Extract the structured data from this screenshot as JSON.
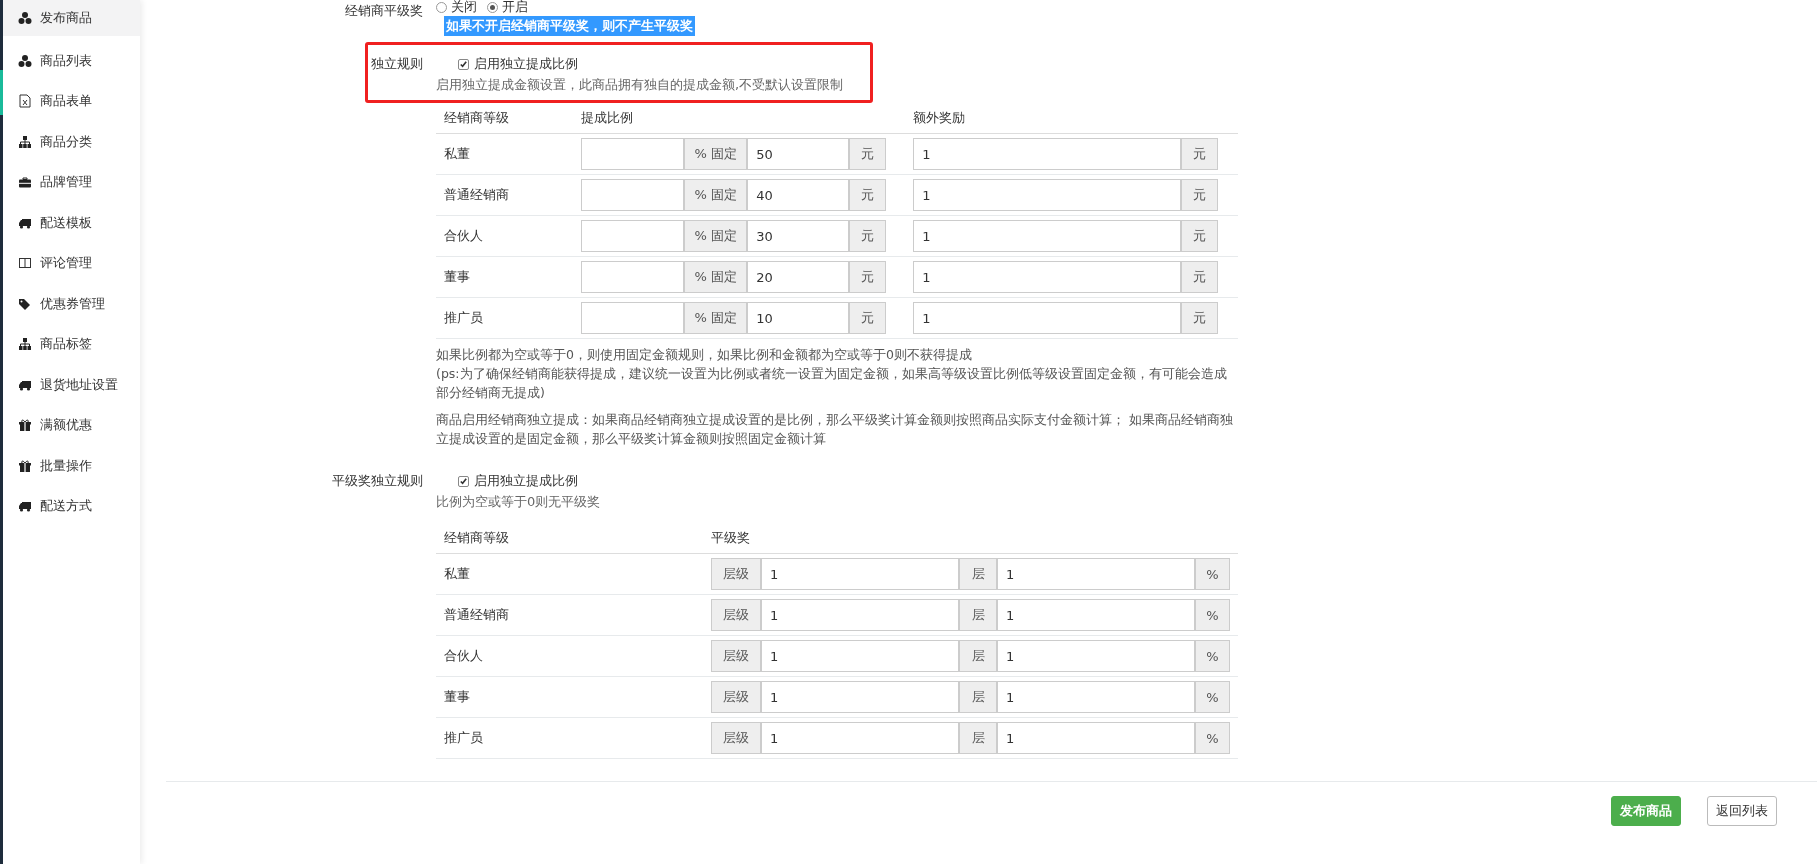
{
  "sidebar": {
    "items": [
      {
        "label": "发布商品",
        "kind": "cubes",
        "selected": true
      },
      {
        "label": "商品列表",
        "kind": "cubes",
        "selected": false
      },
      {
        "label": "商品表单",
        "kind": "file",
        "selected": false
      },
      {
        "label": "商品分类",
        "kind": "sitemap",
        "selected": false
      },
      {
        "label": "品牌管理",
        "kind": "briefcase",
        "selected": false
      },
      {
        "label": "配送模板",
        "kind": "truck",
        "selected": false
      },
      {
        "label": "评论管理",
        "kind": "columns",
        "selected": false
      },
      {
        "label": "优惠券管理",
        "kind": "tags",
        "selected": false
      },
      {
        "label": "商品标签",
        "kind": "sitemap",
        "selected": false
      },
      {
        "label": "退货地址设置",
        "kind": "truck",
        "selected": false
      },
      {
        "label": "满额优惠",
        "kind": "gift",
        "selected": false
      },
      {
        "label": "批量操作",
        "kind": "gift",
        "selected": false
      },
      {
        "label": "配送方式",
        "kind": "truck",
        "selected": false
      }
    ]
  },
  "dealer_flat_award": {
    "label": "经销商平级奖",
    "options": [
      {
        "label": "关闭",
        "selected": false
      },
      {
        "label": "开启",
        "selected": true
      }
    ],
    "hint": "如果不开启经销商平级奖，则不产生平级奖"
  },
  "independent_rule": {
    "label": "独立规则",
    "highlighted": true,
    "checkbox": {
      "label": "启用独立提成比例",
      "checked": true
    },
    "help": "启用独立提成金额设置，此商品拥有独自的提成金额,不受默认设置限制"
  },
  "commission_table": {
    "columns": [
      "经销商等级",
      "提成比例",
      "额外奖励"
    ],
    "rows": [
      {
        "level": "私董",
        "ratio_addon": "% 固定",
        "fixed": "50",
        "fixed_addon": "元",
        "extra": "1",
        "extra_addon": "元"
      },
      {
        "level": "普通经销商",
        "ratio_addon": "% 固定",
        "fixed": "40",
        "fixed_addon": "元",
        "extra": "1",
        "extra_addon": "元"
      },
      {
        "level": "合伙人",
        "ratio_addon": "% 固定",
        "fixed": "30",
        "fixed_addon": "元",
        "extra": "1",
        "extra_addon": "元"
      },
      {
        "level": "董事",
        "ratio_addon": "% 固定",
        "fixed": "20",
        "fixed_addon": "元",
        "extra": "1",
        "extra_addon": "元"
      },
      {
        "level": "推广员",
        "ratio_addon": "% 固定",
        "fixed": "10",
        "fixed_addon": "元",
        "extra": "1",
        "extra_addon": "元"
      }
    ]
  },
  "notes": [
    [
      "如果比例都为空或等于0，则使用固定金额规则，如果比例和金额都为空或等于0则不获得提成",
      "(ps:为了确保经销商能获得提成，建议统一设置为比例或者统一设置为固定金额，如果高等级设置比例低等级设置固定金额，有可能会造成部分经销商无提成)"
    ],
    [
      "商品启用经销商独立提成：如果商品经销商独立提成设置的是比例，那么平级奖计算金额则按照商品实际支付金额计算； 如果商品经销商独立提成设置的是固定金额，那么平级奖计算金额则按照固定金额计算"
    ]
  ],
  "flat_rule": {
    "label": "平级奖独立规则",
    "highlighted": false,
    "checkbox": {
      "label": "启用独立提成比例",
      "checked": true
    },
    "help": "比例为空或等于0则无平级奖"
  },
  "flat_table": {
    "columns": [
      "经销商等级",
      "平级奖"
    ],
    "rows": [
      {
        "level": "私董",
        "level_addon": "层级",
        "layers": "1",
        "layers_addon": "层",
        "percent": "1",
        "percent_addon": "%"
      },
      {
        "level": "普通经销商",
        "level_addon": "层级",
        "layers": "1",
        "layers_addon": "层",
        "percent": "1",
        "percent_addon": "%"
      },
      {
        "level": "合伙人",
        "level_addon": "层级",
        "layers": "1",
        "layers_addon": "层",
        "percent": "1",
        "percent_addon": "%"
      },
      {
        "level": "董事",
        "level_addon": "层级",
        "layers": "1",
        "layers_addon": "层",
        "percent": "1",
        "percent_addon": "%"
      },
      {
        "level": "推广员",
        "level_addon": "层级",
        "layers": "1",
        "layers_addon": "层",
        "percent": "1",
        "percent_addon": "%"
      }
    ]
  },
  "buttons": [
    {
      "label": "发布商品",
      "kind": "primary"
    },
    {
      "label": "返回列表",
      "kind": "default"
    }
  ]
}
